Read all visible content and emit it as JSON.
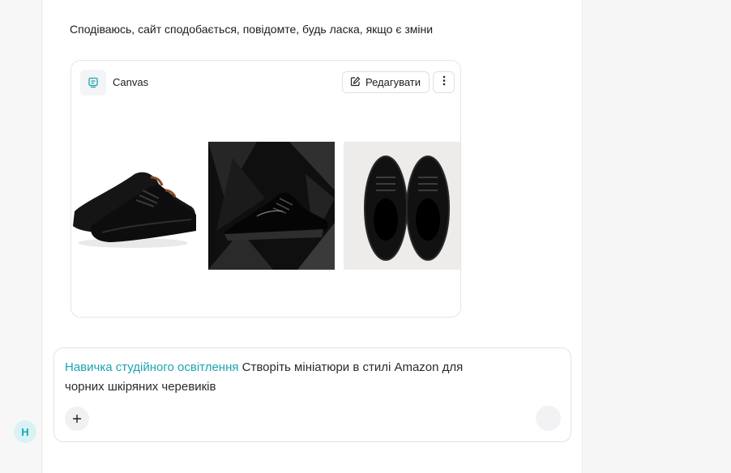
{
  "chat": {
    "message": "Сподіваюсь, сайт сподобається, повідомте, будь ласка, якщо є зміни"
  },
  "canvas": {
    "title": "Canvas",
    "edit_label": "Редагувати",
    "icons": {
      "canvas": "canvas-icon",
      "edit": "pencil-icon",
      "more": "more-vertical-icon"
    },
    "images": [
      {
        "name": "black-oxford-shoes-white-background"
      },
      {
        "name": "black-sneakers-dark-geometric-background"
      },
      {
        "name": "black-sneakers-top-view-light-background"
      }
    ]
  },
  "composer": {
    "skill_tag": "Навичка студійного освітлення",
    "prompt": "Створіть мініатюри в стилі Amazon для чорних шкіряних черевиків",
    "add_icon": "plus-icon",
    "send_icon": "send-icon"
  },
  "user": {
    "avatar_initial": "H"
  },
  "colors": {
    "accent": "#1aa5b3",
    "avatar_bg": "#d9f3f5"
  }
}
